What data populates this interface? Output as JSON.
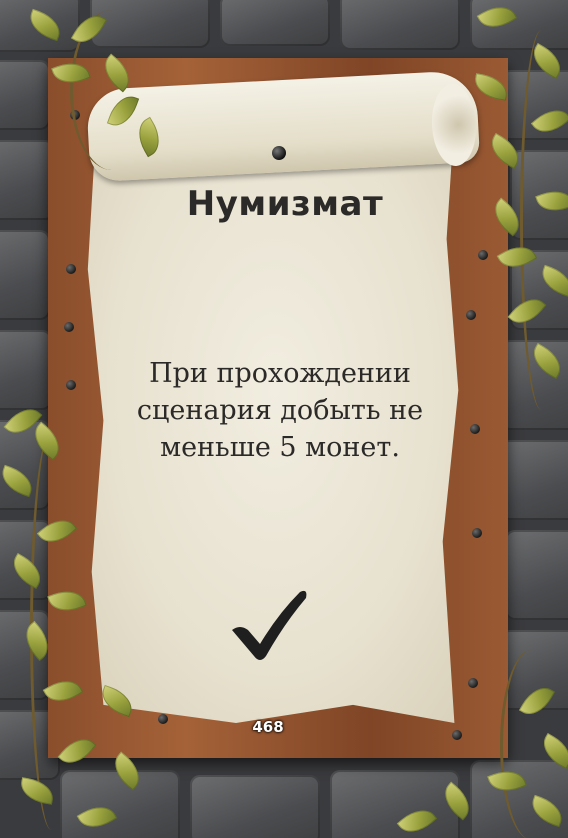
{
  "card": {
    "title": "Нумизмат",
    "description": "При прохождении сценария добыть не меньше 5 монет.",
    "number": "468",
    "icon": "checkmark-icon"
  },
  "colors": {
    "parchment": "#ebe6d4",
    "ink": "#2b2a28",
    "wood": "#8a4e2c",
    "stone": "#56575a",
    "leaf": "#a3a845"
  }
}
